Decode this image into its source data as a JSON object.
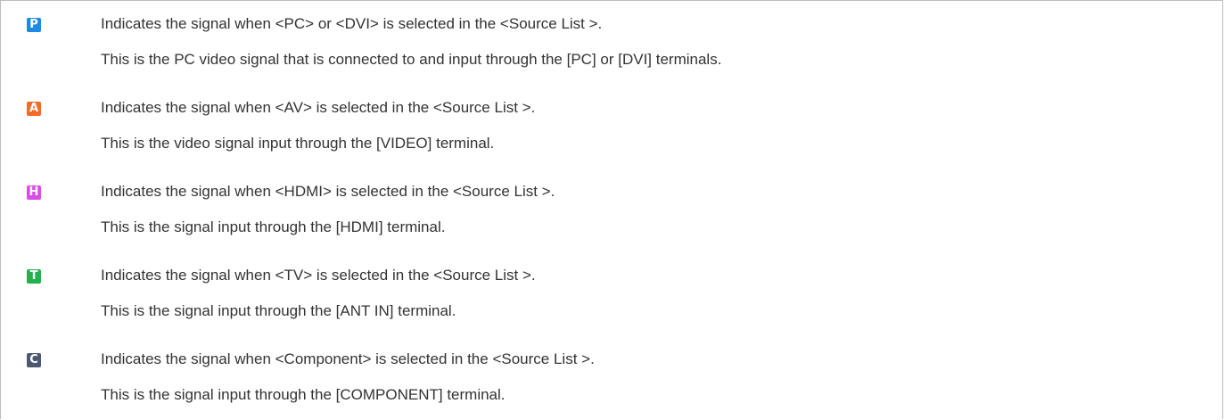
{
  "signals": [
    {
      "icon": "p-letter-icon",
      "letter": "P",
      "color": "#1e88e5",
      "title": "Indicates the signal when <PC> or <DVI> is selected in the <Source List >.",
      "detail": "This is the PC video signal that is connected to and input through the [PC] or [DVI] terminals."
    },
    {
      "icon": "a-letter-icon",
      "letter": "A",
      "color": "#f26b2b",
      "title": "Indicates the signal when <AV> is selected in the <Source List >.",
      "detail": "This is the video signal input through the [VIDEO] terminal."
    },
    {
      "icon": "h-letter-icon",
      "letter": "H",
      "color": "#d84de6",
      "title": "Indicates the signal when <HDMI> is selected in the <Source List >.",
      "detail": "This is the signal input through the [HDMI] terminal."
    },
    {
      "icon": "t-letter-icon",
      "letter": "T",
      "color": "#22b14c",
      "title": "Indicates the signal when <TV> is selected in the <Source List >.",
      "detail": "This is the signal input through the [ANT IN] terminal."
    },
    {
      "icon": "c-letter-icon",
      "letter": "C",
      "color": "#4b5970",
      "title": "Indicates the signal when <Component> is selected in the <Source List >.",
      "detail": "This is the signal input through the [COMPONENT] terminal."
    }
  ]
}
